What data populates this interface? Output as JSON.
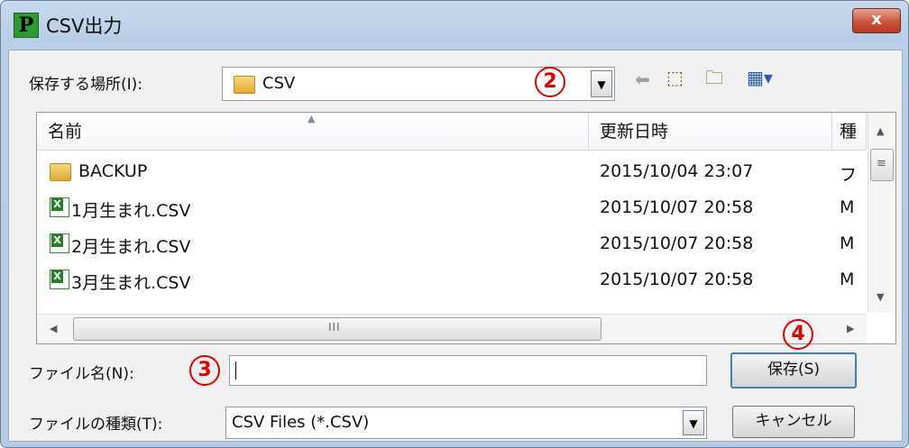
{
  "window": {
    "title": "CSV出力",
    "close_glyph": "x"
  },
  "location": {
    "label": "保存する場所(I):",
    "value": "CSV"
  },
  "columns": {
    "name": "名前",
    "modified": "更新日時",
    "type": "種"
  },
  "files": [
    {
      "name": "BACKUP",
      "modified": "2015/10/04 23:07",
      "type": "フ",
      "icon": "folder-icon"
    },
    {
      "name": "1月生まれ.CSV",
      "modified": "2015/10/07 20:58",
      "type": "M",
      "icon": "excel-csv-icon"
    },
    {
      "name": "2月生まれ.CSV",
      "modified": "2015/10/07 20:58",
      "type": "M",
      "icon": "excel-csv-icon"
    },
    {
      "name": "3月生まれ.CSV",
      "modified": "2015/10/07 20:58",
      "type": "M",
      "icon": "excel-csv-icon"
    }
  ],
  "filename": {
    "label": "ファイル名(N):",
    "value": ""
  },
  "filetype": {
    "label": "ファイルの種類(T):",
    "value": "CSV Files (*.CSV)"
  },
  "buttons": {
    "save": "保存(S)",
    "cancel": "キャンセル"
  },
  "annotations": {
    "n2": "2",
    "n3": "3",
    "n4": "4"
  },
  "scroll": {
    "hscroll_grip": "III"
  },
  "colors": {
    "annotation": "#e00000",
    "close_button": "#c9543b",
    "frame": "#b9cfe8"
  }
}
